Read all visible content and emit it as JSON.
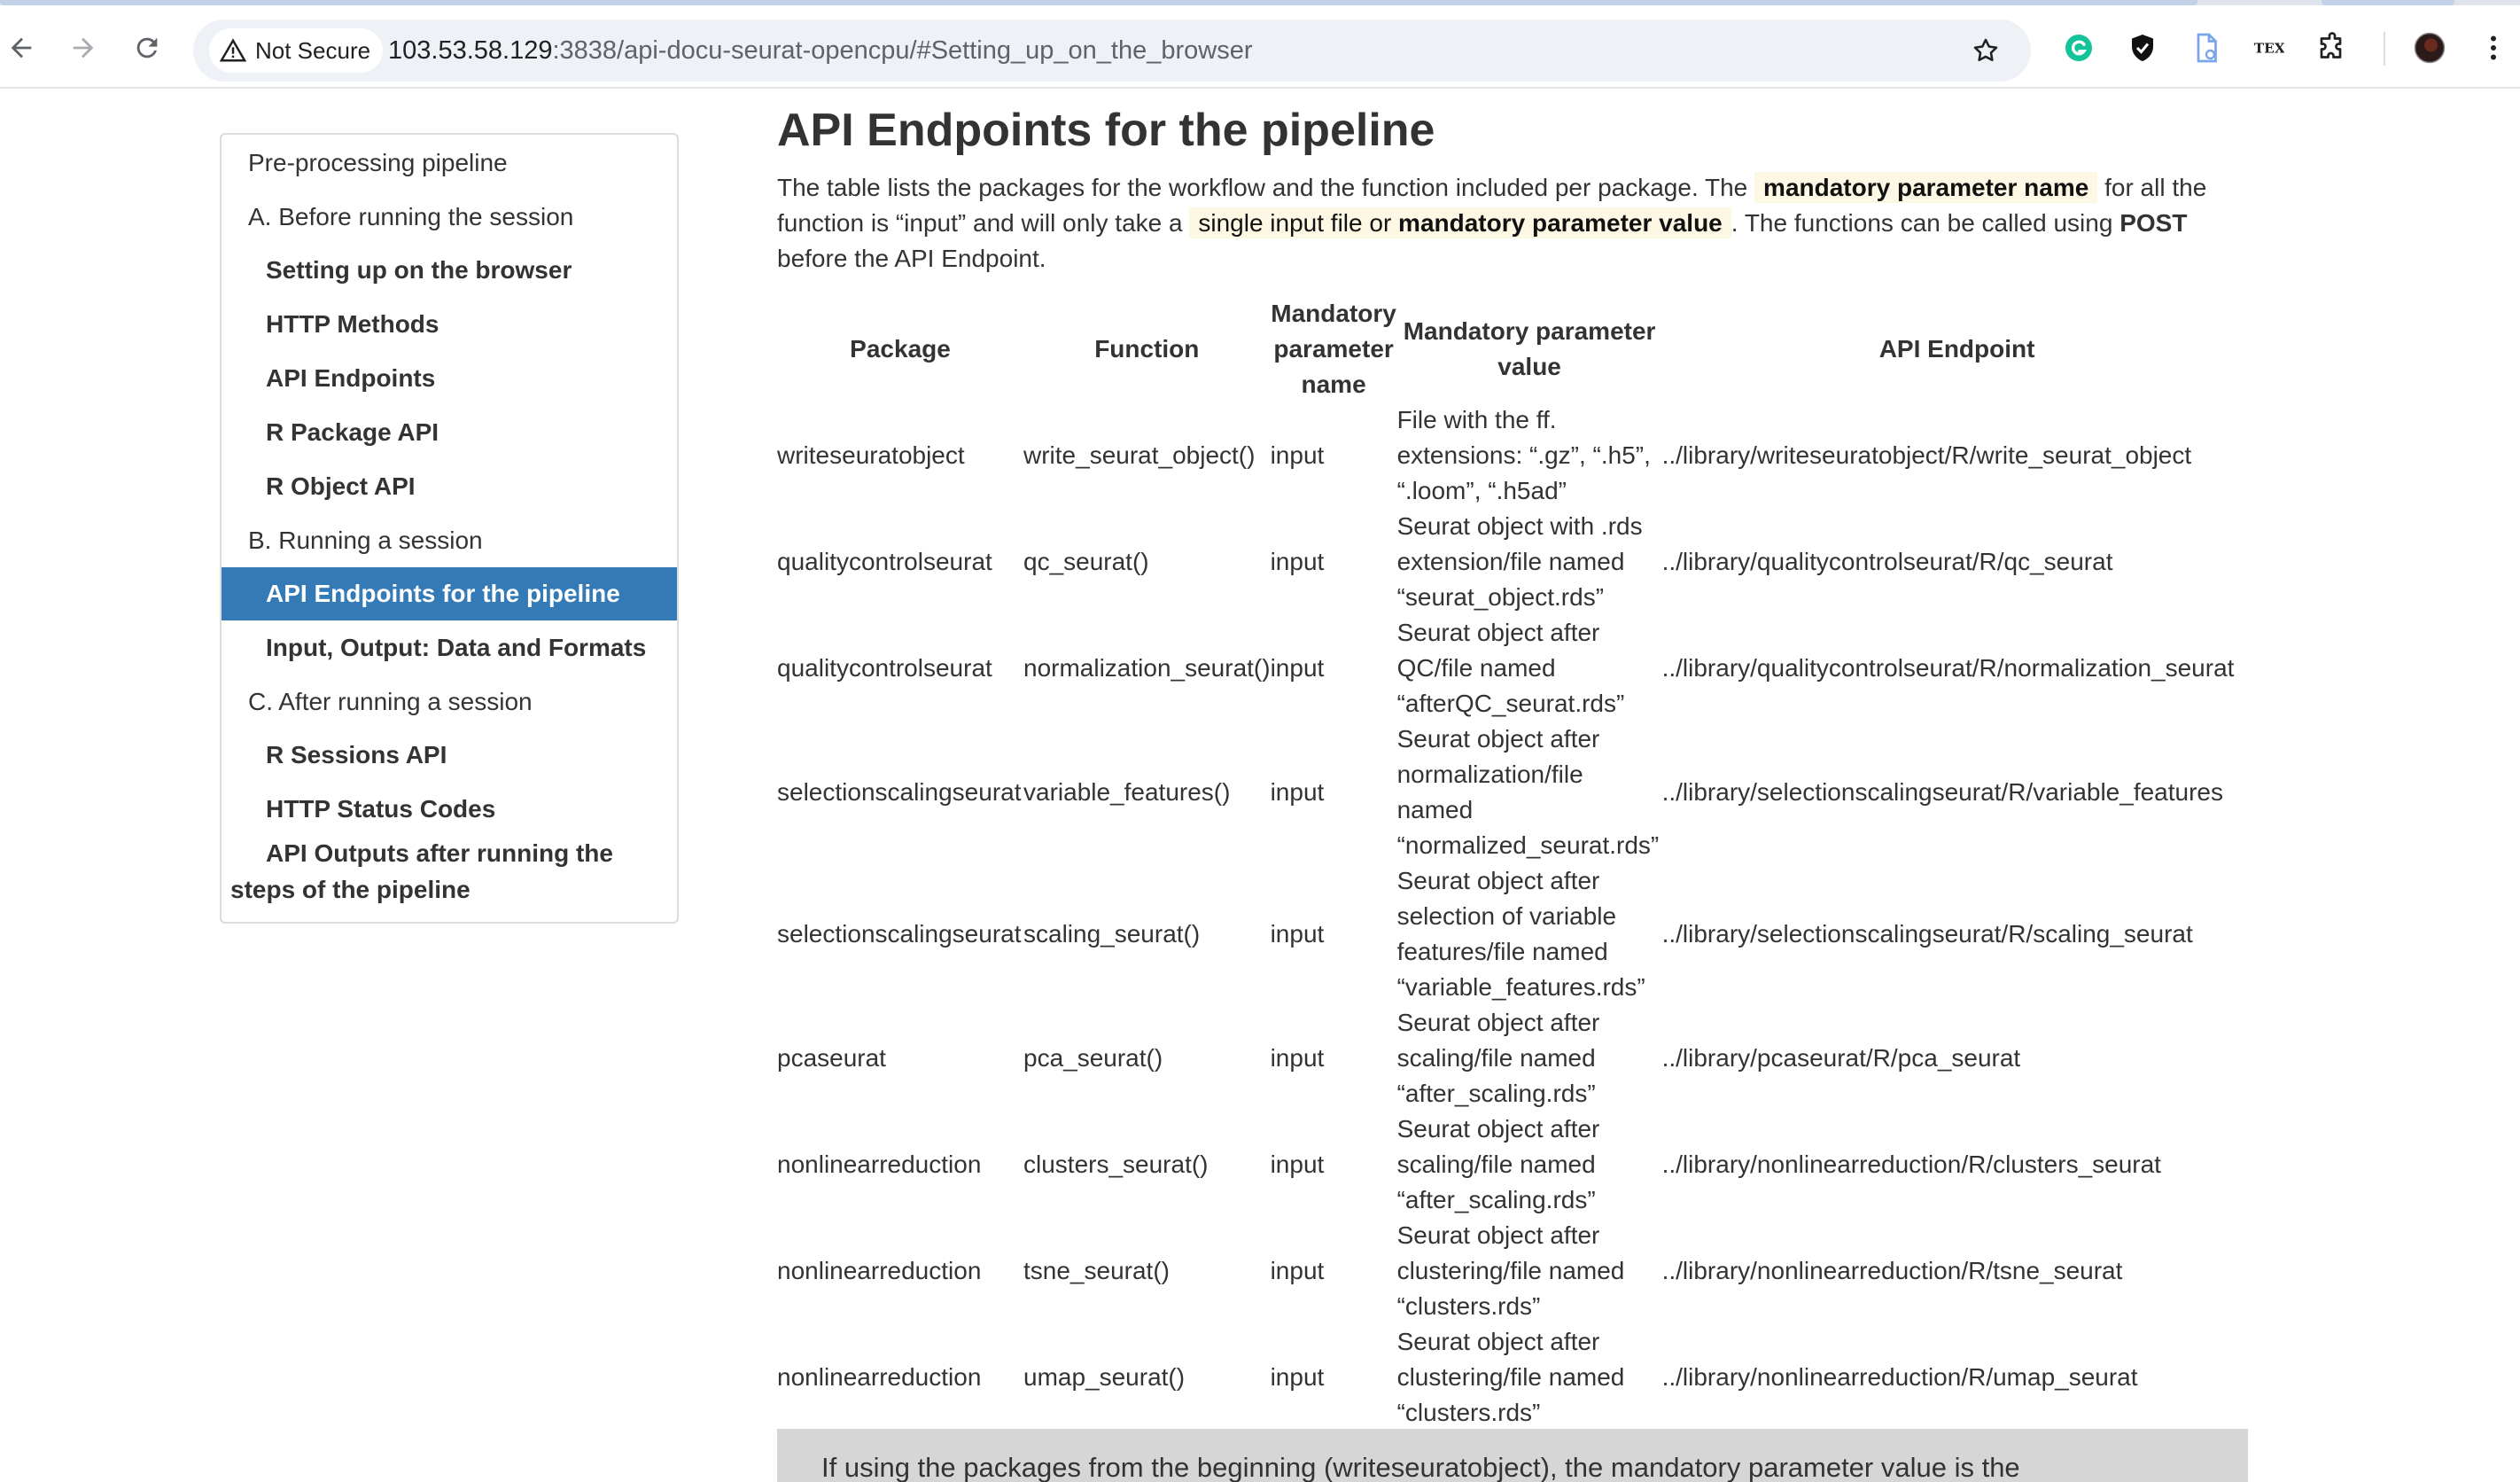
{
  "browser": {
    "security_label": "Not Secure",
    "url_host": "103.53.58.129",
    "url_rest": ":3838/api-docu-seurat-opencpu/#Setting_up_on_the_browser",
    "toolbar_icons": [
      "back-icon",
      "forward-icon",
      "reload-icon",
      "warning-icon",
      "star-icon",
      "grammarly-icon",
      "shield-check-icon",
      "pdf-icon",
      "tex-icon",
      "puzzle-icon",
      "profile-avatar",
      "kebab-menu-icon"
    ],
    "tex_label": "TEX"
  },
  "toc": {
    "items": [
      {
        "label": "Pre-processing pipeline",
        "level": 1
      },
      {
        "label": "A. Before running the session",
        "level": 1
      },
      {
        "label": "Setting up on the browser",
        "level": 2
      },
      {
        "label": "HTTP Methods",
        "level": 2
      },
      {
        "label": "API Endpoints",
        "level": 2
      },
      {
        "label": "R Package API",
        "level": 2
      },
      {
        "label": "R Object API",
        "level": 2
      },
      {
        "label": "B. Running a session",
        "level": 1
      },
      {
        "label": "API Endpoints for the pipeline",
        "level": 2,
        "active": true
      },
      {
        "label": "Input, Output: Data and Formats",
        "level": 2
      },
      {
        "label": "C. After running a session",
        "level": 1
      },
      {
        "label": "R Sessions API",
        "level": 2
      },
      {
        "label": "HTTP Status Codes",
        "level": 2
      },
      {
        "label": "API Outputs after running the steps of the pipeline",
        "level": 2
      }
    ],
    "active_color": "#337ab7"
  },
  "main": {
    "title": "API Endpoints for the pipeline",
    "intro": {
      "p1": "The table lists the packages for the workflow and the function included per package. The ",
      "hl1": "mandatory parameter name",
      "p2": " for all the function is “input” and will only take a ",
      "hl2a": "single input file or ",
      "hl2b": "mandatory parameter value",
      "p3": ". The functions can be called using ",
      "post": "POST",
      "p4": " before the API Endpoint."
    },
    "table": {
      "headers": [
        "Package",
        "Function",
        "Mandatory parameter name",
        "Mandatory parameter value",
        "API Endpoint"
      ],
      "rows": [
        [
          "writeseuratobject",
          "write_seurat_object()",
          "input",
          "File with the ff. extensions: “.gz”, “.h5”, “.loom”, “.h5ad”",
          "../library/writeseuratobject/R/write_seurat_object"
        ],
        [
          "qualitycontrolseurat",
          "qc_seurat()",
          "input",
          "Seurat object with .rds extension/file named “seurat_object.rds”",
          "../library/qualitycontrolseurat/R/qc_seurat"
        ],
        [
          "qualitycontrolseurat",
          "normalization_seurat()",
          "input",
          "Seurat object after QC/file named “afterQC_seurat.rds”",
          "../library/qualitycontrolseurat/R/normalization_seurat"
        ],
        [
          "selectionscalingseurat",
          "variable_features()",
          "input",
          "Seurat object after normalization/file named “normalized_seurat.rds”",
          "../library/selectionscalingseurat/R/variable_features"
        ],
        [
          "selectionscalingseurat",
          "scaling_seurat()",
          "input",
          "Seurat object after selection of variable features/file named “variable_features.rds”",
          "../library/selectionscalingseurat/R/scaling_seurat"
        ],
        [
          "pcaseurat",
          "pca_seurat()",
          "input",
          "Seurat object after scaling/file named “after_scaling.rds”",
          "../library/pcaseurat/R/pca_seurat"
        ],
        [
          "nonlinearreduction",
          "clusters_seurat()",
          "input",
          "Seurat object after scaling/file named “after_scaling.rds”",
          "../library/nonlinearreduction/R/clusters_seurat"
        ],
        [
          "nonlinearreduction",
          "tsne_seurat()",
          "input",
          "Seurat object after clustering/file named “clusters.rds”",
          "../library/nonlinearreduction/R/tsne_seurat"
        ],
        [
          "nonlinearreduction",
          "umap_seurat()",
          "input",
          "Seurat object after clustering/file named “clusters.rds”",
          "../library/nonlinearreduction/R/umap_seurat"
        ]
      ]
    },
    "note_text": "If using the packages from the beginning (writeseuratobject), the mandatory parameter value is the"
  }
}
